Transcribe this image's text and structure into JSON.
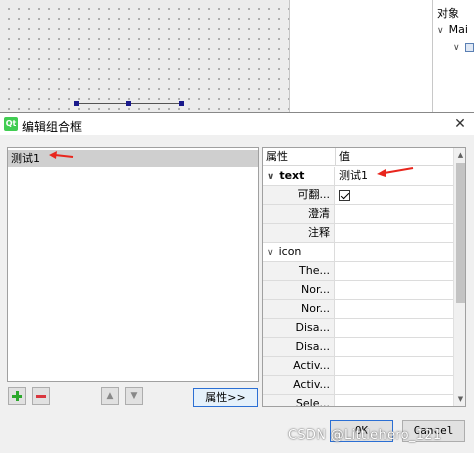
{
  "object_panel": {
    "title": "对象",
    "root_item": "Mai"
  },
  "dialog": {
    "title": "编辑组合框",
    "close_label": "✕",
    "items": [
      {
        "label": "测试1"
      }
    ],
    "properties_button": "属性>>",
    "ok_label": "OK",
    "cancel_label": "Cancel"
  },
  "property_table": {
    "headers": [
      "属性",
      "值"
    ],
    "rows": [
      {
        "name": "text",
        "value": "测试1",
        "kind": "group"
      },
      {
        "name": "可翻...",
        "value": "",
        "kind": "checkbox",
        "checked": true
      },
      {
        "name": "澄清",
        "value": "",
        "kind": "sub"
      },
      {
        "name": "注释",
        "value": "",
        "kind": "sub"
      },
      {
        "name": "icon",
        "value": "",
        "kind": "group"
      },
      {
        "name": "The...",
        "value": "",
        "kind": "sub"
      },
      {
        "name": "Nor...",
        "value": "",
        "kind": "sub"
      },
      {
        "name": "Nor...",
        "value": "",
        "kind": "sub"
      },
      {
        "name": "Disa...",
        "value": "",
        "kind": "sub"
      },
      {
        "name": "Disa...",
        "value": "",
        "kind": "sub"
      },
      {
        "name": "Activ...",
        "value": "",
        "kind": "sub"
      },
      {
        "name": "Activ...",
        "value": "",
        "kind": "sub"
      },
      {
        "name": "Sele...",
        "value": "",
        "kind": "sub"
      }
    ]
  },
  "watermark": "CSDN @Littlehero_121",
  "colors": {
    "accent": "#2b6fd4",
    "annotation": "#e8261d",
    "qt_green": "#41cd52"
  }
}
